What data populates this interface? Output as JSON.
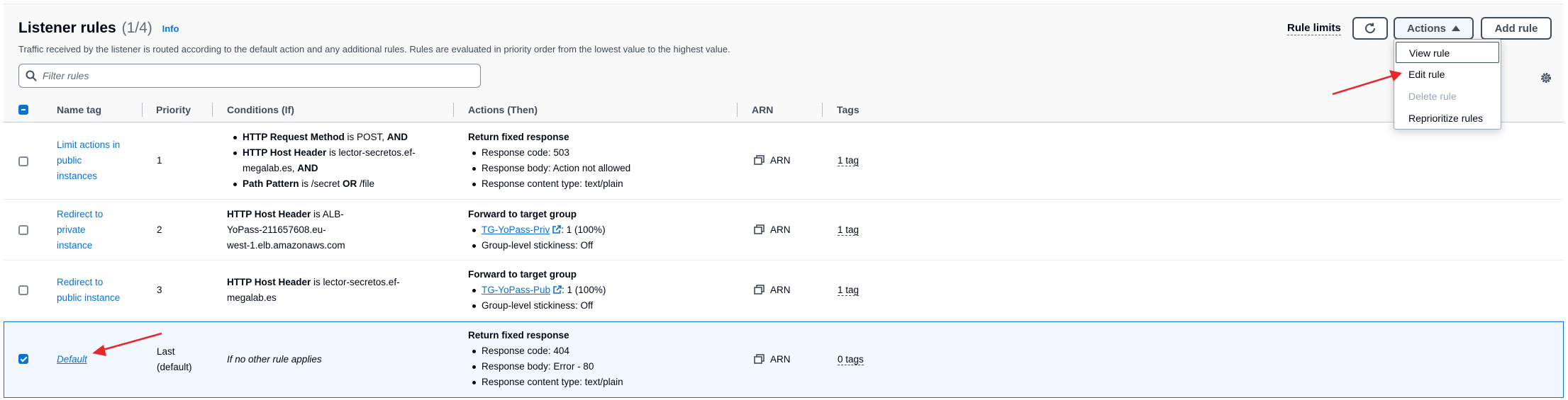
{
  "header": {
    "title": "Listener rules",
    "count": "(1/4)",
    "info": "Info",
    "description": "Traffic received by the listener is routed according to the default action and any additional rules. Rules are evaluated in priority order from the lowest value to the highest value."
  },
  "toolbar": {
    "rule_limits": "Rule limits",
    "actions_label": "Actions",
    "add_rule_label": "Add rule"
  },
  "actions_menu": {
    "view_rule": "View rule",
    "edit_rule": "Edit rule",
    "delete_rule": "Delete rule",
    "reprioritize_rules": "Reprioritize rules"
  },
  "search": {
    "placeholder": "Filter rules"
  },
  "columns": {
    "name_tag": "Name tag",
    "priority": "Priority",
    "conditions": "Conditions (If)",
    "actions": "Actions (Then)",
    "arn": "ARN",
    "tags": "Tags"
  },
  "rows": [
    {
      "name_lines": [
        "Limit actions in",
        "public",
        "instances"
      ],
      "priority": "1",
      "conditions": {
        "c1_key": "HTTP Request Method",
        "c1_rest": " is POST, ",
        "c1_and": "AND",
        "c2_key": "HTTP Host Header",
        "c2_rest": " is lector-secretos.ef-",
        "c2_rest2": "megalab.es, ",
        "c2_and": "AND",
        "c3_key": "Path Pattern",
        "c3_rest": " is /secret ",
        "c3_or": "OR",
        "c3_rest2": " /file"
      },
      "action_title": "Return fixed response",
      "action_items": [
        "Response code: 503",
        "Response body: Action not allowed",
        "Response content type: text/plain"
      ],
      "arn": "ARN",
      "tags": "1 tag"
    },
    {
      "name_lines": [
        "Redirect to",
        "private",
        "instance"
      ],
      "priority": "2",
      "cond_key": "HTTP Host Header",
      "cond_lines": [
        " is ALB-",
        "YoPass-211657608.eu-",
        "west-1.elb.amazonaws.com"
      ],
      "action_title": "Forward to target group",
      "target_group": "TG-YoPass-Priv",
      "target_weight": ": 1 (100%)",
      "stickiness": "Group-level stickiness: Off",
      "arn": "ARN",
      "tags": "1 tag"
    },
    {
      "name_lines": [
        "Redirect to",
        "public instance"
      ],
      "priority": "3",
      "cond_key": "HTTP Host Header",
      "cond_lines": [
        " is lector-secretos.ef-",
        "megalab.es"
      ],
      "action_title": "Forward to target group",
      "target_group": "TG-YoPass-Pub",
      "target_weight": ": 1 (100%)",
      "stickiness": "Group-level stickiness: Off",
      "arn": "ARN",
      "tags": "1 tag"
    },
    {
      "name": "Default",
      "priority_lines": [
        "Last",
        "(default)"
      ],
      "condition": "If no other rule applies",
      "action_title": "Return fixed response",
      "action_items": [
        "Response code: 404",
        "Response body: Error - 80",
        "Response content type: text/plain"
      ],
      "arn": "ARN",
      "tags": "0 tags"
    }
  ],
  "colors": {
    "link": "#0972d3",
    "annotation_arrow": "#e8262d",
    "text": "#000716",
    "selected_row_bg": "#f2f8fd"
  },
  "icons": [
    "search-icon",
    "refresh-icon",
    "caret-up-icon",
    "settings-gear-icon",
    "copy-icon",
    "external-link-icon",
    "red-arrow-annotation"
  ]
}
